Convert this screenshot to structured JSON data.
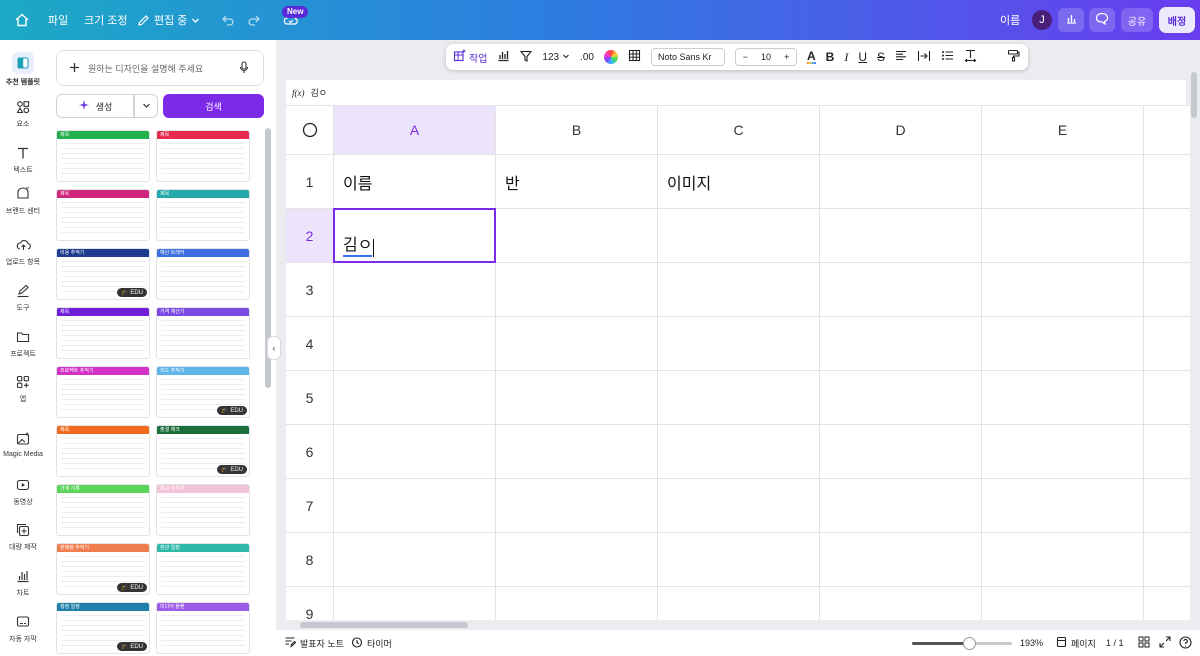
{
  "topbar": {
    "home_icon": "home-icon",
    "file_label": "파일",
    "resize_label": "크기 조정",
    "edit_mode_label": "편집 중",
    "new_badge": "New",
    "name_label": "이름",
    "avatar_initial": "J",
    "share_label": "공유",
    "publish_label": "배정"
  },
  "rail": [
    {
      "label": "추천 템플릿",
      "icon": "template-icon",
      "active": true
    },
    {
      "label": "요소",
      "icon": "elements-icon"
    },
    {
      "label": "텍스트",
      "icon": "text-icon"
    },
    {
      "label": "브랜드 센터",
      "icon": "brand-icon"
    },
    {
      "label": "업로드 항목",
      "icon": "upload-icon"
    },
    {
      "label": "도구",
      "icon": "draw-icon"
    },
    {
      "label": "프로젝트",
      "icon": "folder-icon"
    },
    {
      "label": "앱",
      "icon": "apps-icon"
    },
    {
      "label": "Magic Media",
      "icon": "magic-media-icon"
    },
    {
      "label": "동영상",
      "icon": "video-icon"
    },
    {
      "label": "대량 제작",
      "icon": "bulk-create-icon"
    },
    {
      "label": "차트",
      "icon": "chart-icon"
    },
    {
      "label": "자동 자막",
      "icon": "caption-icon"
    }
  ],
  "panel": {
    "search_placeholder": "원하는 디자인을 설명해 주세요",
    "generate_label": "생성",
    "search_label": "검색",
    "thumbs": [
      {
        "title": "제목",
        "color": "#21b04b",
        "edu": false
      },
      {
        "title": "제목",
        "color": "#e8284c",
        "edu": false
      },
      {
        "title": "제목",
        "color": "#d0257a",
        "edu": false
      },
      {
        "title": "제목",
        "color": "#23a9a9",
        "edu": false
      },
      {
        "title": "비용 추적기",
        "color": "#1d3b8f",
        "edu": true
      },
      {
        "title": "예산 트래커",
        "color": "#3d6fe0",
        "edu": false
      },
      {
        "title": "제목",
        "color": "#6f1fd8",
        "edu": false
      },
      {
        "title": "가격 계산기",
        "color": "#7b4ae3",
        "edu": false
      },
      {
        "title": "프로젝트 추적기",
        "color": "#d332c8",
        "edu": false
      },
      {
        "title": "리드 추적기",
        "color": "#5fb4e8",
        "edu": true
      },
      {
        "title": "제목",
        "color": "#f06a1d",
        "edu": false
      },
      {
        "title": "출결 체크",
        "color": "#1c6e3a",
        "edu": true
      },
      {
        "title": "가계 기록",
        "color": "#5bd45a",
        "edu": false
      },
      {
        "title": "재고 추적기",
        "color": "#f2c3d9",
        "edu": false
      },
      {
        "title": "판매량 추적기",
        "color": "#f07d4d",
        "edu": true
      },
      {
        "title": "현관 일정",
        "color": "#2fb8a8",
        "edu": false
      },
      {
        "title": "행정 일정",
        "color": "#1e7fa8",
        "edu": true
      },
      {
        "title": "미디어 플랜",
        "color": "#9c5be8",
        "edu": false
      }
    ]
  },
  "toolbar": {
    "action_label": "작업",
    "number_format": "123",
    "decimal_label": ".00",
    "font_name": "Noto Sans Kr",
    "font_size": "10"
  },
  "formula": {
    "fx_label": "f(x)",
    "value": "김ㅇ"
  },
  "sheet": {
    "columns": [
      "A",
      "B",
      "C",
      "D",
      "E"
    ],
    "rows": [
      "1",
      "2",
      "3",
      "4",
      "5",
      "6",
      "7",
      "8",
      "9"
    ],
    "cells": {
      "A1": "이름",
      "B1": "반",
      "C1": "이미지",
      "A2": "김ㅇ"
    },
    "selected_cell": "A2"
  },
  "bottom": {
    "notes_label": "발표자 노트",
    "timer_label": "타이머",
    "zoom_value": "193%",
    "zoom_fraction": 0.57,
    "pages_label": "페이지",
    "page_count": "1 / 1"
  },
  "colors": {
    "accent": "#7d2ae8",
    "selected_header_bg": "#ece4fb"
  }
}
